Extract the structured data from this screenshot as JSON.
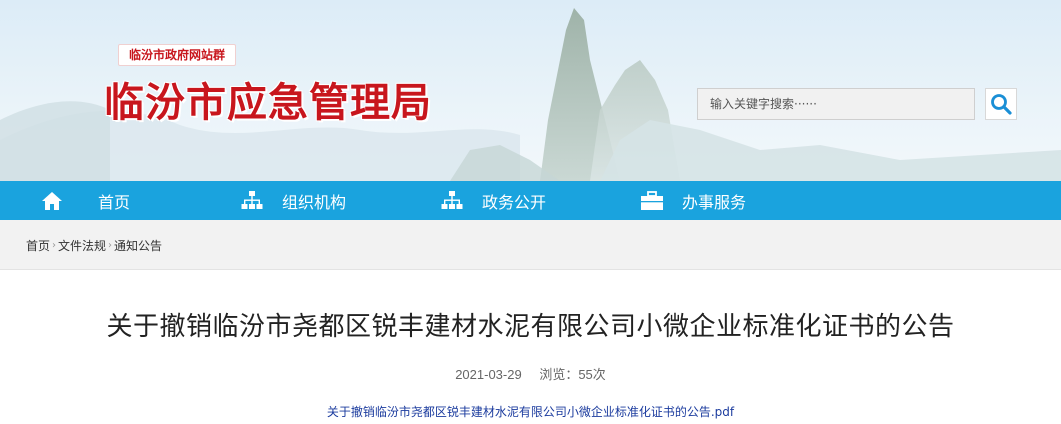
{
  "header": {
    "group_tag": "临汾市政府网站群",
    "site_title": "临汾市应急管理局",
    "search": {
      "placeholder": "输入关键字搜索······",
      "value": ""
    },
    "search_icon": "search-icon"
  },
  "nav": {
    "items": [
      {
        "label": "首页",
        "icon": "home-icon"
      },
      {
        "label": "组织机构",
        "icon": "org-chart-icon"
      },
      {
        "label": "政务公开",
        "icon": "org-chart-icon"
      },
      {
        "label": "办事服务",
        "icon": "briefcase-icon"
      }
    ],
    "bg_color": "#1aa3de"
  },
  "breadcrumb": {
    "items": [
      "首页",
      "文件法规",
      "通知公告"
    ],
    "separator": "›"
  },
  "article": {
    "title": "关于撤销临汾市尧都区锐丰建材水泥有限公司小微企业标准化证书的公告",
    "date": "2021-03-29",
    "views": "浏览：55次",
    "attachment": "关于撤销临汾市尧都区锐丰建材水泥有限公司小微企业标准化证书的公告.pdf"
  },
  "colors": {
    "title_red": "#c8161d",
    "link_blue": "#1b3b9e"
  }
}
